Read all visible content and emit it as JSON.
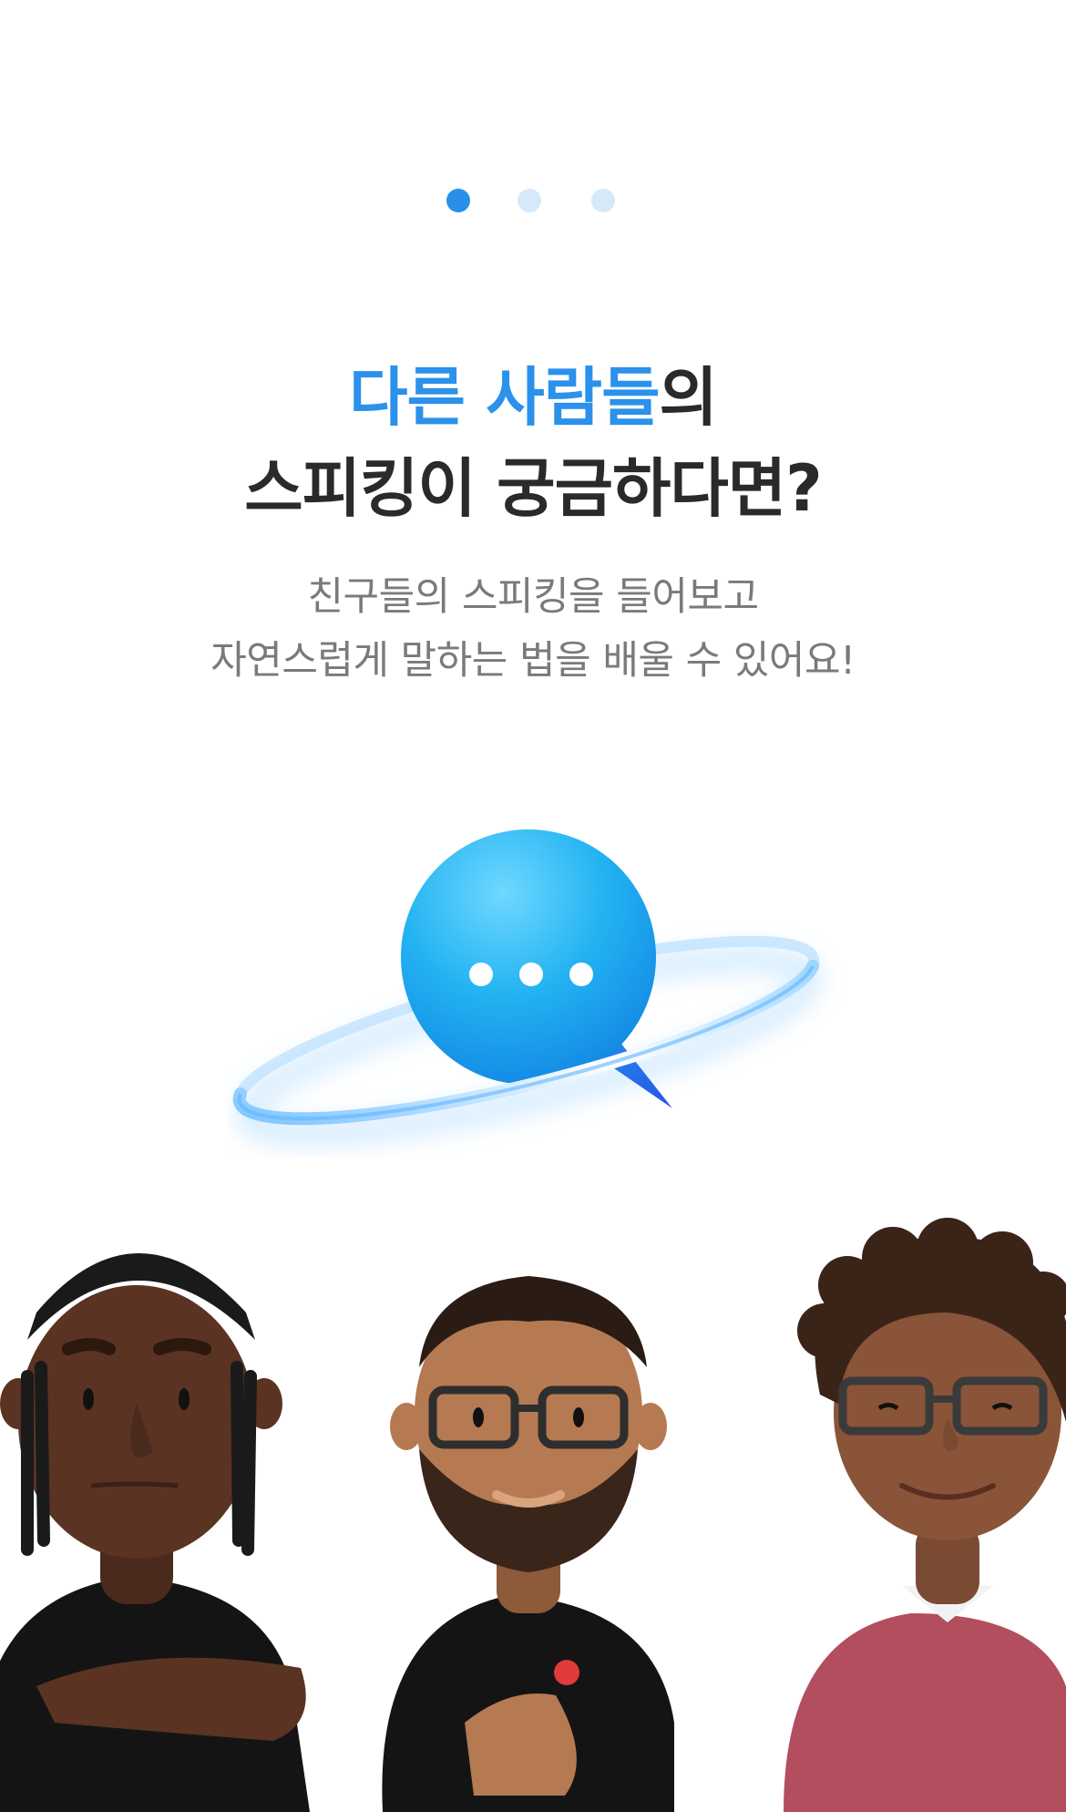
{
  "pager": {
    "pages": [
      {
        "active": true
      },
      {
        "active": false
      },
      {
        "active": false
      }
    ],
    "active_color": "#2890ea",
    "inactive_color": "#d6e9fb"
  },
  "headline": {
    "line1_accent": "다른 사람들",
    "line1_rest": "의",
    "line2": "스피킹이 궁금하다면?",
    "accent_color": "#2b91eb"
  },
  "description": {
    "line1": "친구들의 스피킹을 들어보고",
    "line2": "자연스럽게 말하는 법을 배울 수 있어요!"
  },
  "illustrations": {
    "hero": "chat-planet-icon",
    "characters": [
      "avatar-braids",
      "avatar-bearded-glasses",
      "avatar-curly-glasses"
    ]
  }
}
